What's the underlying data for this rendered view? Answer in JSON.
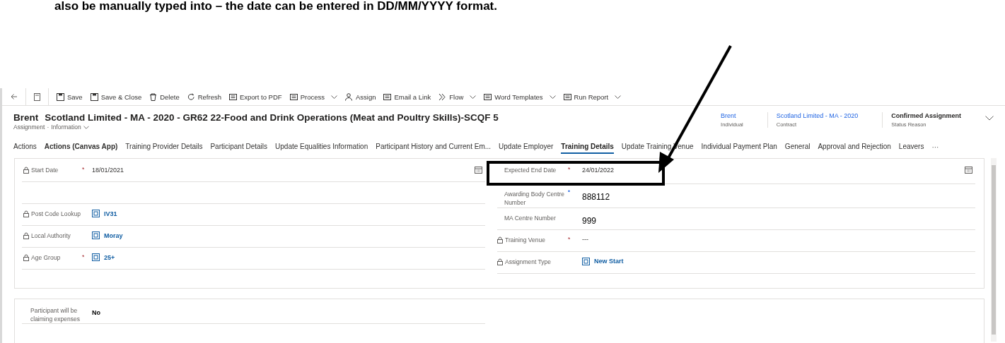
{
  "caption": "also be manually typed into – the date can be entered in DD/MM/YYYY format.",
  "toolbar": [
    {
      "label": "Save",
      "caret": false
    },
    {
      "label": "Save & Close",
      "caret": false
    },
    {
      "label": "Delete",
      "caret": false
    },
    {
      "label": "Refresh",
      "caret": false
    },
    {
      "label": "Export to PDF",
      "caret": false
    },
    {
      "label": "Process",
      "caret": true
    },
    {
      "label": "Assign",
      "caret": false
    },
    {
      "label": "Email a Link",
      "caret": false
    },
    {
      "label": "Flow",
      "caret": true
    },
    {
      "label": "Word Templates",
      "caret": true
    },
    {
      "label": "Run Report",
      "caret": true
    }
  ],
  "record": {
    "separator": "·",
    "name": "Brent",
    "title": "Scotland Limited - MA - 2020 - GR62 22-Food and Drink Operations (Meat and Poultry Skills)-SCQF 5",
    "entity": "Assignment",
    "form": "Information"
  },
  "header_fields": [
    {
      "value": "Brent",
      "label": "Individual",
      "kind": "link"
    },
    {
      "value": "Scotland Limited - MA - 2020",
      "label": "Contract",
      "kind": "link"
    },
    {
      "value": "Confirmed Assignment",
      "label": "Status Reason",
      "kind": "bold"
    }
  ],
  "tabs": [
    {
      "label": "Actions",
      "selected": false
    },
    {
      "label": "Actions (Canvas App)",
      "selected": false,
      "emphasis": true
    },
    {
      "label": "Training Provider Details",
      "selected": false
    },
    {
      "label": "Participant Details",
      "selected": false
    },
    {
      "label": "Update Equalities Information",
      "selected": false
    },
    {
      "label": "Participant History and Current Em...",
      "selected": false
    },
    {
      "label": "Update Employer",
      "selected": false
    },
    {
      "label": "Training Details",
      "selected": true
    },
    {
      "label": "Update Training Venue",
      "selected": false
    },
    {
      "label": "Individual Payment Plan",
      "selected": false
    },
    {
      "label": "General",
      "selected": false
    },
    {
      "label": "Approval and Rejection",
      "selected": false
    },
    {
      "label": "Leavers",
      "selected": false
    }
  ],
  "more_tabs": "···",
  "left_fields": [
    {
      "label": "Start Date",
      "locked": true,
      "required_mark": "*",
      "value": "18/01/2021",
      "kind": "date"
    },
    {
      "kind": "empty"
    },
    {
      "label": "Post Code Lookup",
      "locked": true,
      "value": "IV31",
      "kind": "lookup"
    },
    {
      "label": "Local Authority",
      "locked": true,
      "value": "Moray",
      "kind": "lookup"
    },
    {
      "label": "Age Group",
      "locked": true,
      "required_mark": "*",
      "value": "25+",
      "kind": "lookup"
    }
  ],
  "right_fields": [
    {
      "label": "Expected End Date",
      "locked": false,
      "required_mark": "*",
      "value": "24/01/2022",
      "kind": "date"
    },
    {
      "label": "Awarding Body Centre Number",
      "locked": false,
      "recommended_mark": "•",
      "value": "888112",
      "kind": "number"
    },
    {
      "label": "MA Centre Number",
      "locked": false,
      "value": "999",
      "kind": "number"
    },
    {
      "label": "Training Venue",
      "locked": true,
      "required_mark": "*",
      "value": "---",
      "kind": "text"
    },
    {
      "label": "Assignment Type",
      "locked": true,
      "value": "New Start",
      "kind": "lookup"
    }
  ],
  "expenses_field": {
    "label": "Participant will be claiming expenses",
    "value": "No"
  }
}
